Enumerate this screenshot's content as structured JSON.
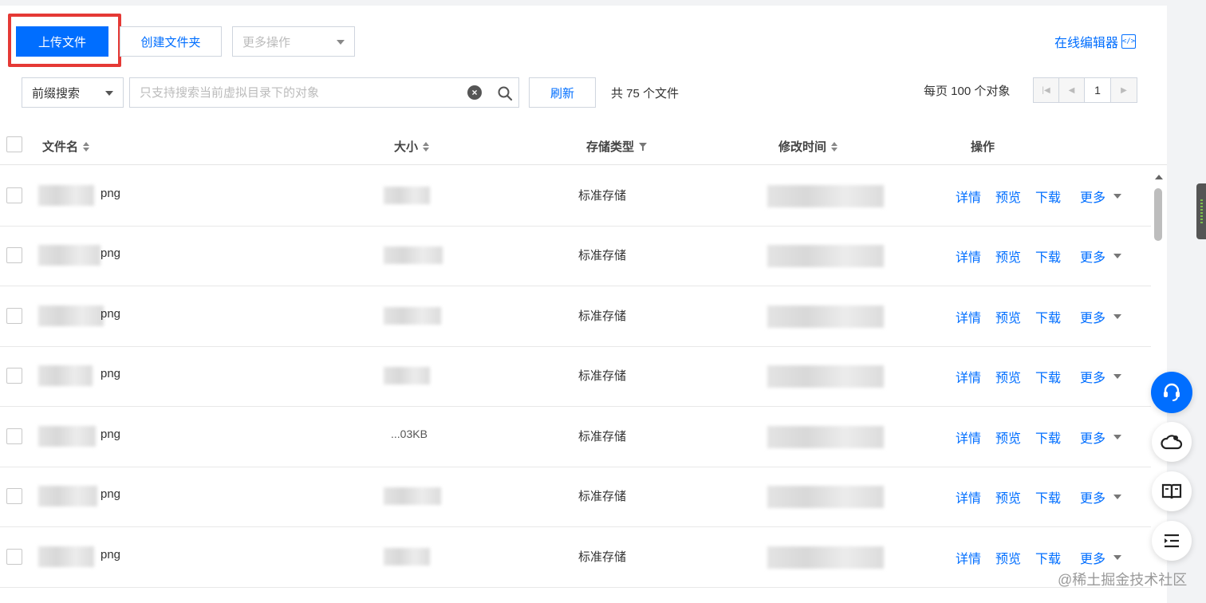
{
  "toolbar": {
    "upload_label": "上传文件",
    "create_folder_label": "创建文件夹",
    "more_actions_placeholder": "更多操作",
    "online_editor_label": "在线编辑器",
    "online_editor_icon": "code-window-icon"
  },
  "search": {
    "mode_label": "前缀搜索",
    "placeholder": "只支持搜索当前虚拟目录下的对象",
    "value": "",
    "refresh_label": "刷新",
    "total_label": "共 75 个文件"
  },
  "pagination": {
    "per_page_label": "每页 100 个对象",
    "current_page": "1"
  },
  "table": {
    "columns": {
      "name": "文件名",
      "size": "大小",
      "storage_type": "存储类型",
      "modified": "修改时间",
      "actions": "操作"
    },
    "rows": [
      {
        "name_visible": "png",
        "size_visible": "",
        "storage": "标准存储"
      },
      {
        "name_visible": "png",
        "size_visible": "",
        "storage": "标准存储"
      },
      {
        "name_visible": "png",
        "size_visible": "",
        "storage": "标准存储"
      },
      {
        "name_visible": "png",
        "size_visible": "",
        "storage": "标准存储"
      },
      {
        "name_visible": "png",
        "size_visible": "...03KB",
        "storage": "标准存储"
      },
      {
        "name_visible": "png",
        "size_visible": "",
        "storage": "标准存储"
      },
      {
        "name_visible": "png",
        "size_visible": "",
        "storage": "标准存储"
      }
    ],
    "row_actions": {
      "detail": "详情",
      "preview": "预览",
      "download": "下载",
      "more": "更多"
    }
  },
  "floating_actions": [
    "headset-icon",
    "cloud-icon",
    "book-icon",
    "list-indent-icon"
  ],
  "watermark": "@稀土掘金技术社区",
  "colors": {
    "primary": "#006eff",
    "highlight": "#e53935"
  }
}
